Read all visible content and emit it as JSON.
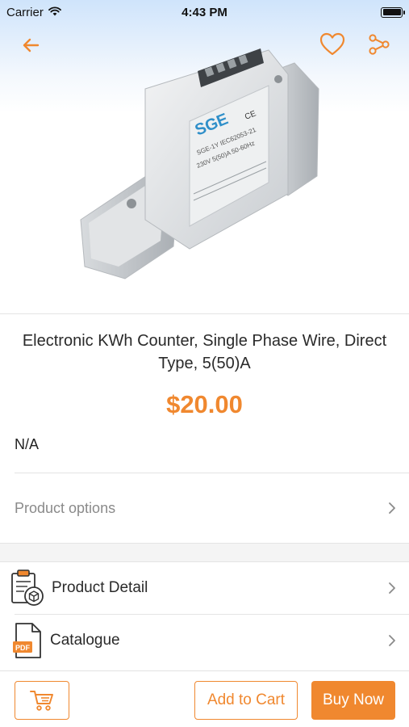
{
  "status_bar": {
    "carrier": "Carrier",
    "time": "4:43 PM"
  },
  "hero": {
    "back_icon": "arrow-left-icon",
    "favorite_icon": "heart-icon",
    "share_icon": "share-icon",
    "image": {
      "brand": "SGE",
      "model": "SGE-1Y",
      "rating": "5(50)A"
    }
  },
  "product": {
    "title": "Electronic KWh Counter, Single Phase Wire, Direct Type, 5(50)A",
    "price": "$20.00",
    "sku": "N/A"
  },
  "options": {
    "label": "Product options"
  },
  "sections": [
    {
      "label": "Product Detail",
      "icon": "clipboard-box-icon"
    },
    {
      "label": "Catalogue",
      "icon": "pdf-document-icon",
      "badge": "PDF"
    }
  ],
  "actions": {
    "cart_icon": "cart-icon",
    "add_to_cart": "Add to Cart",
    "buy_now": "Buy Now"
  },
  "colors": {
    "accent": "#f0882f",
    "text": "#2a2a2a",
    "muted": "#8a8a8a"
  }
}
